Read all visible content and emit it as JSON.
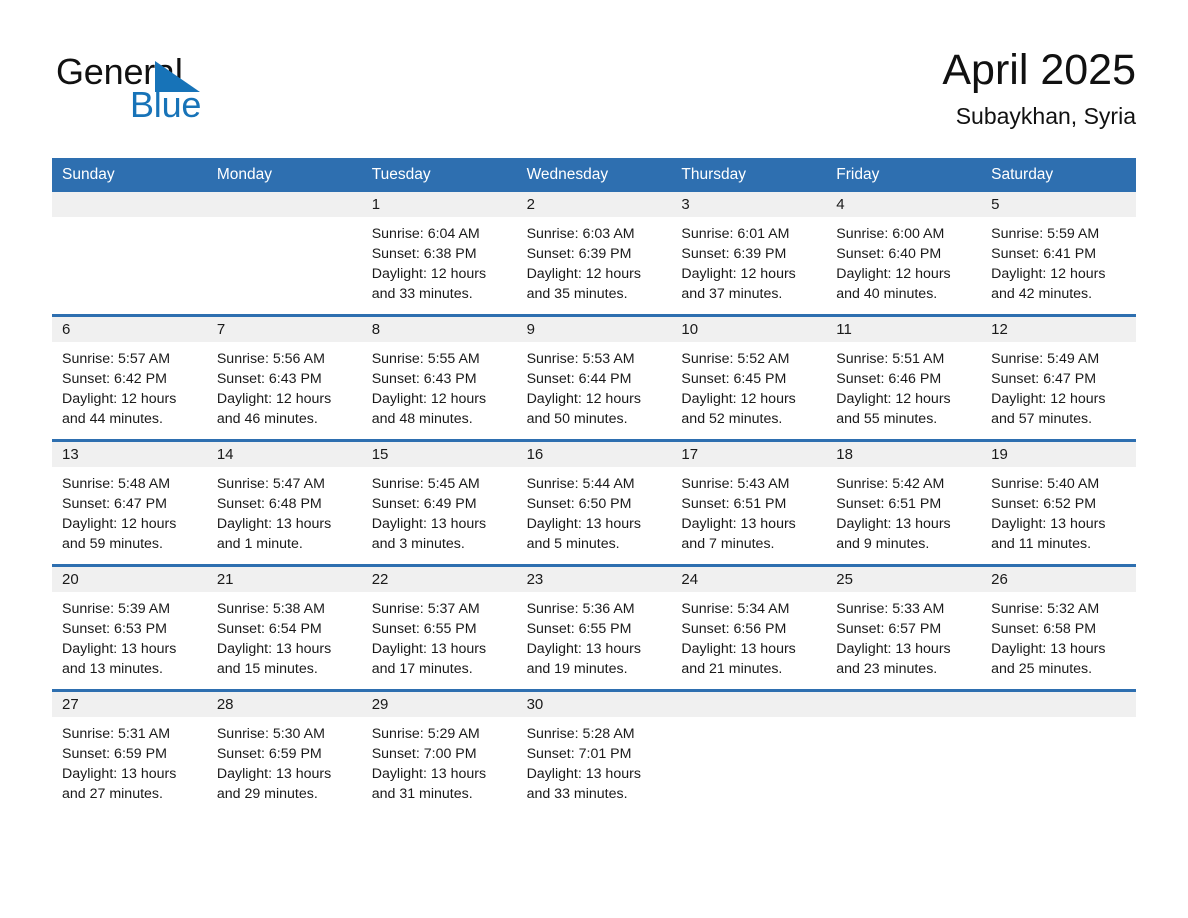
{
  "brand": {
    "name_part1": "General",
    "name_part2": "Blue",
    "triangle_color": "#1773b8",
    "text_color": "#111111"
  },
  "header": {
    "title": "April 2025",
    "subtitle": "Subaykhan, Syria"
  },
  "theme": {
    "header_blue": "#2e6fb0",
    "row_separator_blue": "#2e6fb0",
    "day_band_gray": "#f0f0f0",
    "cell_white": "#ffffff",
    "text_color": "#1a1a1a"
  },
  "weekdays": [
    "Sunday",
    "Monday",
    "Tuesday",
    "Wednesday",
    "Thursday",
    "Friday",
    "Saturday"
  ],
  "weeks": [
    [
      {
        "day": "",
        "sunrise": "",
        "sunset": "",
        "daylight": ""
      },
      {
        "day": "",
        "sunrise": "",
        "sunset": "",
        "daylight": ""
      },
      {
        "day": "1",
        "sunrise": "Sunrise: 6:04 AM",
        "sunset": "Sunset: 6:38 PM",
        "daylight": "Daylight: 12 hours and 33 minutes."
      },
      {
        "day": "2",
        "sunrise": "Sunrise: 6:03 AM",
        "sunset": "Sunset: 6:39 PM",
        "daylight": "Daylight: 12 hours and 35 minutes."
      },
      {
        "day": "3",
        "sunrise": "Sunrise: 6:01 AM",
        "sunset": "Sunset: 6:39 PM",
        "daylight": "Daylight: 12 hours and 37 minutes."
      },
      {
        "day": "4",
        "sunrise": "Sunrise: 6:00 AM",
        "sunset": "Sunset: 6:40 PM",
        "daylight": "Daylight: 12 hours and 40 minutes."
      },
      {
        "day": "5",
        "sunrise": "Sunrise: 5:59 AM",
        "sunset": "Sunset: 6:41 PM",
        "daylight": "Daylight: 12 hours and 42 minutes."
      }
    ],
    [
      {
        "day": "6",
        "sunrise": "Sunrise: 5:57 AM",
        "sunset": "Sunset: 6:42 PM",
        "daylight": "Daylight: 12 hours and 44 minutes."
      },
      {
        "day": "7",
        "sunrise": "Sunrise: 5:56 AM",
        "sunset": "Sunset: 6:43 PM",
        "daylight": "Daylight: 12 hours and 46 minutes."
      },
      {
        "day": "8",
        "sunrise": "Sunrise: 5:55 AM",
        "sunset": "Sunset: 6:43 PM",
        "daylight": "Daylight: 12 hours and 48 minutes."
      },
      {
        "day": "9",
        "sunrise": "Sunrise: 5:53 AM",
        "sunset": "Sunset: 6:44 PM",
        "daylight": "Daylight: 12 hours and 50 minutes."
      },
      {
        "day": "10",
        "sunrise": "Sunrise: 5:52 AM",
        "sunset": "Sunset: 6:45 PM",
        "daylight": "Daylight: 12 hours and 52 minutes."
      },
      {
        "day": "11",
        "sunrise": "Sunrise: 5:51 AM",
        "sunset": "Sunset: 6:46 PM",
        "daylight": "Daylight: 12 hours and 55 minutes."
      },
      {
        "day": "12",
        "sunrise": "Sunrise: 5:49 AM",
        "sunset": "Sunset: 6:47 PM",
        "daylight": "Daylight: 12 hours and 57 minutes."
      }
    ],
    [
      {
        "day": "13",
        "sunrise": "Sunrise: 5:48 AM",
        "sunset": "Sunset: 6:47 PM",
        "daylight": "Daylight: 12 hours and 59 minutes."
      },
      {
        "day": "14",
        "sunrise": "Sunrise: 5:47 AM",
        "sunset": "Sunset: 6:48 PM",
        "daylight": "Daylight: 13 hours and 1 minute."
      },
      {
        "day": "15",
        "sunrise": "Sunrise: 5:45 AM",
        "sunset": "Sunset: 6:49 PM",
        "daylight": "Daylight: 13 hours and 3 minutes."
      },
      {
        "day": "16",
        "sunrise": "Sunrise: 5:44 AM",
        "sunset": "Sunset: 6:50 PM",
        "daylight": "Daylight: 13 hours and 5 minutes."
      },
      {
        "day": "17",
        "sunrise": "Sunrise: 5:43 AM",
        "sunset": "Sunset: 6:51 PM",
        "daylight": "Daylight: 13 hours and 7 minutes."
      },
      {
        "day": "18",
        "sunrise": "Sunrise: 5:42 AM",
        "sunset": "Sunset: 6:51 PM",
        "daylight": "Daylight: 13 hours and 9 minutes."
      },
      {
        "day": "19",
        "sunrise": "Sunrise: 5:40 AM",
        "sunset": "Sunset: 6:52 PM",
        "daylight": "Daylight: 13 hours and 11 minutes."
      }
    ],
    [
      {
        "day": "20",
        "sunrise": "Sunrise: 5:39 AM",
        "sunset": "Sunset: 6:53 PM",
        "daylight": "Daylight: 13 hours and 13 minutes."
      },
      {
        "day": "21",
        "sunrise": "Sunrise: 5:38 AM",
        "sunset": "Sunset: 6:54 PM",
        "daylight": "Daylight: 13 hours and 15 minutes."
      },
      {
        "day": "22",
        "sunrise": "Sunrise: 5:37 AM",
        "sunset": "Sunset: 6:55 PM",
        "daylight": "Daylight: 13 hours and 17 minutes."
      },
      {
        "day": "23",
        "sunrise": "Sunrise: 5:36 AM",
        "sunset": "Sunset: 6:55 PM",
        "daylight": "Daylight: 13 hours and 19 minutes."
      },
      {
        "day": "24",
        "sunrise": "Sunrise: 5:34 AM",
        "sunset": "Sunset: 6:56 PM",
        "daylight": "Daylight: 13 hours and 21 minutes."
      },
      {
        "day": "25",
        "sunrise": "Sunrise: 5:33 AM",
        "sunset": "Sunset: 6:57 PM",
        "daylight": "Daylight: 13 hours and 23 minutes."
      },
      {
        "day": "26",
        "sunrise": "Sunrise: 5:32 AM",
        "sunset": "Sunset: 6:58 PM",
        "daylight": "Daylight: 13 hours and 25 minutes."
      }
    ],
    [
      {
        "day": "27",
        "sunrise": "Sunrise: 5:31 AM",
        "sunset": "Sunset: 6:59 PM",
        "daylight": "Daylight: 13 hours and 27 minutes."
      },
      {
        "day": "28",
        "sunrise": "Sunrise: 5:30 AM",
        "sunset": "Sunset: 6:59 PM",
        "daylight": "Daylight: 13 hours and 29 minutes."
      },
      {
        "day": "29",
        "sunrise": "Sunrise: 5:29 AM",
        "sunset": "Sunset: 7:00 PM",
        "daylight": "Daylight: 13 hours and 31 minutes."
      },
      {
        "day": "30",
        "sunrise": "Sunrise: 5:28 AM",
        "sunset": "Sunset: 7:01 PM",
        "daylight": "Daylight: 13 hours and 33 minutes."
      },
      {
        "day": "",
        "sunrise": "",
        "sunset": "",
        "daylight": ""
      },
      {
        "day": "",
        "sunrise": "",
        "sunset": "",
        "daylight": ""
      },
      {
        "day": "",
        "sunrise": "",
        "sunset": "",
        "daylight": ""
      }
    ]
  ]
}
